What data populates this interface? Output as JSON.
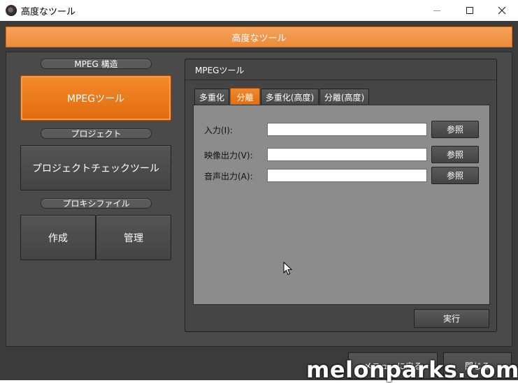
{
  "window": {
    "title": "高度なツール"
  },
  "app": {
    "header": "高度なツール",
    "sections": {
      "mpeg_structure": "MPEG 構造",
      "project": "プロジェクト",
      "proxy_file": "プロキシファイル"
    },
    "left_buttons": {
      "mpeg_tool": "MPEGツール",
      "project_check_tool": "プロジェクトチェックツール",
      "create": "作成",
      "manage": "管理"
    },
    "tool_panel": {
      "title": "MPEGツール",
      "tabs": [
        {
          "label": "多重化",
          "active": false
        },
        {
          "label": "分離",
          "active": true
        },
        {
          "label": "多重化(高度)",
          "active": false
        },
        {
          "label": "分離(高度)",
          "active": false
        }
      ],
      "fields": [
        {
          "label": "入力(I):",
          "value": "",
          "button": "参照"
        },
        {
          "label": "映像出力(V):",
          "value": "",
          "button": "参照"
        },
        {
          "label": "音声出力(A):",
          "value": "",
          "button": "参照"
        }
      ],
      "run_button": "実行"
    },
    "bottom_buttons": {
      "back_to_menu": "メニューに戻る",
      "close": "閉じる"
    }
  },
  "watermark": "melonparks.com",
  "colors": {
    "accent_orange": "#ec7a1e",
    "background_dark": "#3b3b3b"
  }
}
